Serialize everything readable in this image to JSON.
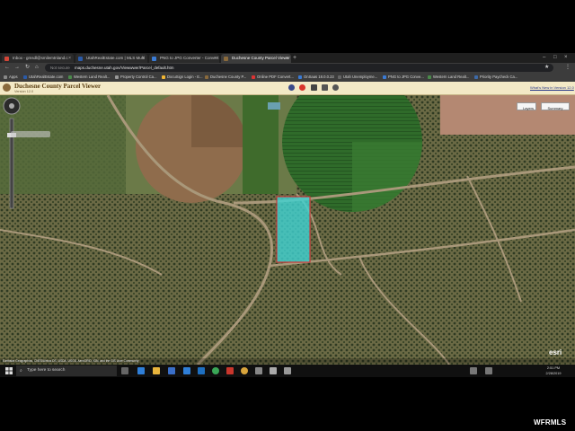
{
  "browser": {
    "tabs": [
      {
        "label": "Inbox - gmsdl@smilemtnland.c",
        "color": "#d44638"
      },
      {
        "label": "UtahRealEstate.com | MLS Multi",
        "color": "#2a5aa8"
      },
      {
        "label": "PNG to JPG Converter - Convert",
        "color": "#3a7bd5"
      },
      {
        "label": "Duchesne County Parcel Viewer",
        "color": "#8a6a3c"
      }
    ],
    "new_tab": "+",
    "address": {
      "security": "Not secure",
      "url": "maps.duchesne.utah.gov/Viewwwer/Parcel_default.htm"
    },
    "bookmarks": [
      {
        "label": "Apps",
        "color": "#888888"
      },
      {
        "label": "UtahRealEstate.com",
        "color": "#2a5aa8"
      },
      {
        "label": "Western Land Realt...",
        "color": "#4a8a4a"
      },
      {
        "label": "Property Control Ca...",
        "color": "#999999"
      },
      {
        "label": "DocuSign Login - E...",
        "color": "#f2b632"
      },
      {
        "label": "Duchesne County P...",
        "color": "#8a6a3c"
      },
      {
        "label": "Online PDF Convert...",
        "color": "#d33"
      },
      {
        "label": "OnSaas 18.0.0.23",
        "color": "#3a7bd5"
      },
      {
        "label": "Utah Unemployme...",
        "color": "#666666"
      },
      {
        "label": "PNG to JPG Conve...",
        "color": "#3a7bd5"
      },
      {
        "label": "Western Land Realt...",
        "color": "#4a8a4a"
      },
      {
        "label": "Priority Paycheck Ca...",
        "color": "#3d6aa8"
      }
    ]
  },
  "app": {
    "title": "Duchesne County Parcel Viewer",
    "version": "Version 12.0",
    "whats_new": "What's New in Version 12.0",
    "tools": [
      {
        "icon": "bike-icon",
        "color": "#3a4a8a"
      },
      {
        "icon": "stop-icon",
        "color": "#d9342b"
      },
      {
        "icon": "print-icon",
        "color": "#444444"
      },
      {
        "icon": "truck-icon",
        "color": "#555555"
      },
      {
        "icon": "help-icon",
        "color": "#555555"
      }
    ]
  },
  "map": {
    "buttons": [
      "Layers",
      "Summary"
    ],
    "zoom_label": "",
    "esri": "esri",
    "attribution": "Earthstar Geographics, CNES/Airbus DS, USDA, USGS, AeroGRID, IGN, and the GIS User Community",
    "parcel_color": "#3fd3d3"
  },
  "taskbar": {
    "search_placeholder": "Type here to search",
    "time": "2:51 PM",
    "date": "2/28/2019"
  },
  "watermark": "WFRMLS"
}
